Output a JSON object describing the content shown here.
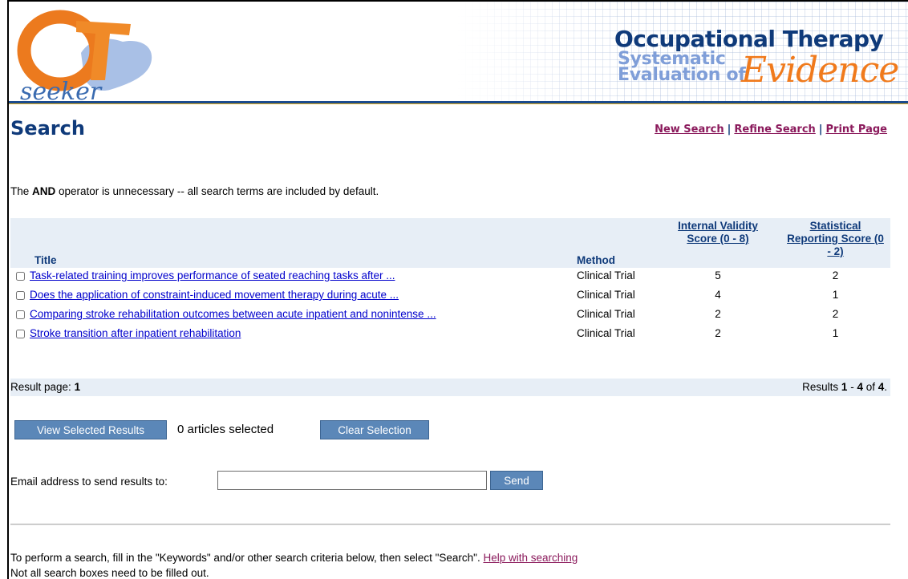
{
  "colors": {
    "navy": "#0f3a7a",
    "link_magenta": "#8b1a5c",
    "link_blue": "#0000cc",
    "header_rule": "#1a4a8c",
    "accent_gold": "#e8b31a",
    "orange": "#f07a1c",
    "table_head_bg": "#e7eef6",
    "button_bg": "#5b87b8"
  },
  "header": {
    "logo_alt": "OT Seeker logo",
    "brand_line1": "Occupational Therapy",
    "brand_line2": "Systematic",
    "brand_line3": "Evaluation of",
    "brand_line4": "Evidence"
  },
  "page_title": "Search",
  "top_links": {
    "new_search": "New Search",
    "refine_search": "Refine Search",
    "print_page": "Print Page",
    "separator": "|"
  },
  "notice": {
    "prefix": "The ",
    "keyword": "AND",
    "suffix": " operator is unnecessary -- all search terms are included by default."
  },
  "results_table": {
    "headers": {
      "title": "Title",
      "method": "Method",
      "internal_validity": "Internal Validity Score (0 - 8)",
      "statistical_reporting": "Statistical Reporting Score (0 - 2)"
    },
    "rows": [
      {
        "title": "Task-related training improves performance of seated reaching tasks after ...",
        "method": "Clinical Trial",
        "internal_validity": "5",
        "statistical_reporting": "2"
      },
      {
        "title": "Does the application of constraint-induced movement therapy during acute ...",
        "method": "Clinical Trial",
        "internal_validity": "4",
        "statistical_reporting": "1"
      },
      {
        "title": "Comparing stroke rehabilitation outcomes between acute inpatient and nonintense ...",
        "method": "Clinical Trial",
        "internal_validity": "2",
        "statistical_reporting": "2"
      },
      {
        "title": "Stroke transition after inpatient rehabilitation",
        "method": "Clinical Trial",
        "internal_validity": "2",
        "statistical_reporting": "1"
      }
    ]
  },
  "pagination": {
    "result_page_label": "Result page: ",
    "current_page": "1",
    "results_prefix": "Results ",
    "range_start": "1",
    "range_sep": " - ",
    "range_end": "4",
    "of_label": " of ",
    "total": "4",
    "period": "."
  },
  "actions": {
    "view_selected": "View Selected Results",
    "selected_count": "0 articles selected",
    "clear_selection": "Clear Selection",
    "email_label": "Email address to send results to:",
    "email_value": "",
    "send": "Send"
  },
  "footer": {
    "line1_text": "To perform a search, fill in the \"Keywords\" and/or other search criteria below, then select \"Search\".",
    "help_link": "Help with searching",
    "line2": "Not all search boxes need to be filled out."
  }
}
